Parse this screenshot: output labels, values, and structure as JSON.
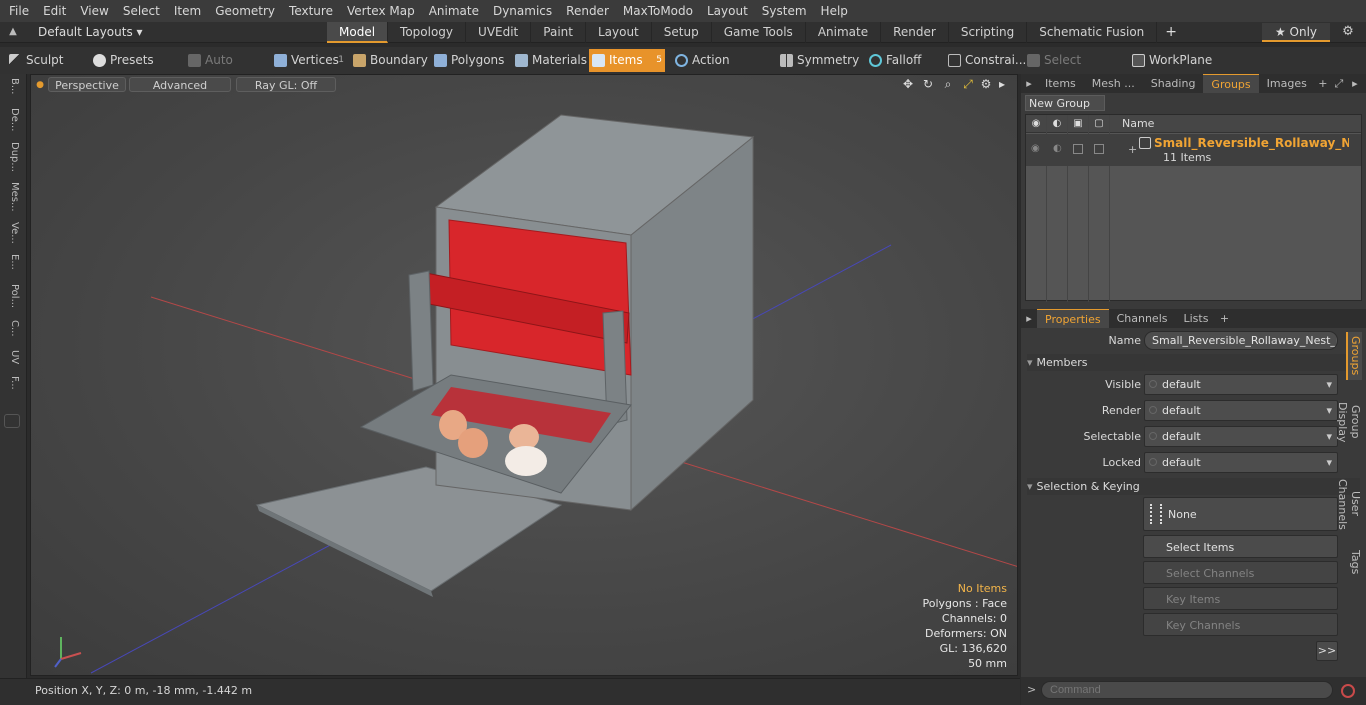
{
  "menu": [
    "File",
    "Edit",
    "View",
    "Select",
    "Item",
    "Geometry",
    "Texture",
    "Vertex Map",
    "Animate",
    "Dynamics",
    "Render",
    "MaxToModo",
    "Layout",
    "System",
    "Help"
  ],
  "layoutbar": {
    "layouts": "Default Layouts ▾",
    "only": "★ Only"
  },
  "modetabs": [
    {
      "label": "Model",
      "active": true
    },
    {
      "label": "Topology"
    },
    {
      "label": "UVEdit"
    },
    {
      "label": "Paint"
    },
    {
      "label": "Layout"
    },
    {
      "label": "Setup"
    },
    {
      "label": "Game Tools"
    },
    {
      "label": "Animate"
    },
    {
      "label": "Render"
    },
    {
      "label": "Scripting"
    },
    {
      "label": "Schematic Fusion"
    }
  ],
  "toolbar": {
    "sculpt": "Sculpt",
    "presets": "Presets",
    "auto_select": "Auto Select",
    "vertices": "Vertices",
    "vertices_count": "1",
    "boundary": "Boundary",
    "polygons": "Polygons",
    "materials": "Materials",
    "items": "Items",
    "items_count": "5",
    "action_center": "Action Center",
    "symmetry": "Symmetry",
    "falloff": "Falloff",
    "constraints": "Constrai...",
    "select_through": "Select Through",
    "workplane": "WorkPlane"
  },
  "leftstrip": [
    "B...",
    "De...",
    "Dup...",
    "Mes...",
    "Ve...",
    "E...",
    "Pol...",
    "C...",
    "UV",
    "F..."
  ],
  "viewport": {
    "perspective": "Perspective",
    "advanced": "Advanced",
    "raygl": "Ray GL: Off",
    "hud": {
      "items": "No Items",
      "polygons": "Polygons : Face",
      "channels": "Channels: 0",
      "deformers": "Deformers: ON",
      "gl": "GL: 136,620",
      "units": "50 mm"
    }
  },
  "status": {
    "position": "Position X, Y, Z:   0 m, -18 mm, -1.442 m"
  },
  "right_top_tabs": [
    {
      "label": "Items"
    },
    {
      "label": "Mesh ..."
    },
    {
      "label": "Shading"
    },
    {
      "label": "Groups",
      "active": true
    },
    {
      "label": "Images"
    }
  ],
  "groups": {
    "new_group": "New Group",
    "name_header": "Name",
    "name": "Small_Reversible_Rollaway_Nes...",
    "sub": "11 Items"
  },
  "properties_tabs": [
    {
      "label": "Properties",
      "active": true
    },
    {
      "label": "Channels"
    },
    {
      "label": "Lists"
    }
  ],
  "properties": {
    "name_label": "Name",
    "name_value": "Small_Reversible_Rollaway_Nest_Box",
    "members": "Members",
    "visible_label": "Visible",
    "visible": "default",
    "render_label": "Render",
    "render": "default",
    "selectable_label": "Selectable",
    "selectable": "default",
    "locked_label": "Locked",
    "locked": "default",
    "selection_keying": "Selection & Keying",
    "none": "None",
    "select_items": "Select Items",
    "select_channels": "Select Channels",
    "key_items": "Key Items",
    "key_channels": "Key Channels",
    "more": ">>"
  },
  "vtabs": [
    "Groups",
    "Group Display",
    "User Channels",
    "Tags"
  ],
  "command": {
    "prompt": ">",
    "placeholder": "Command"
  },
  "colors": {
    "accent": "#e8932a",
    "selected_text": "#f0a434"
  }
}
